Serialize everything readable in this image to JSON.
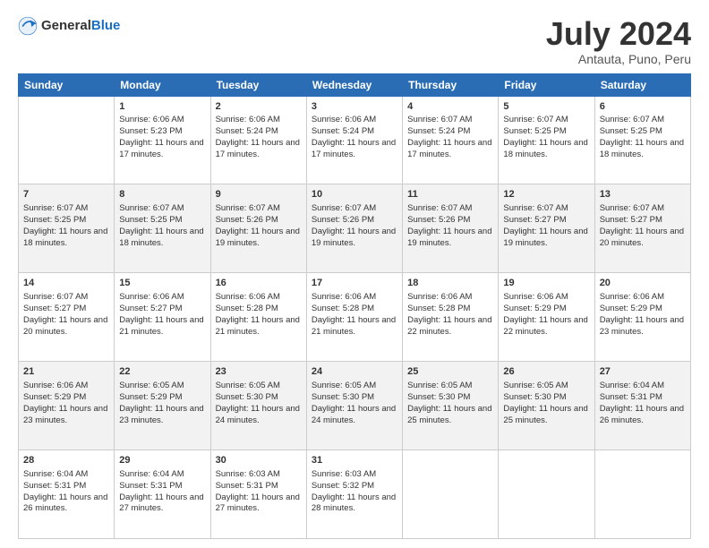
{
  "header": {
    "logo": {
      "general": "General",
      "blue": "Blue"
    },
    "title": "July 2024",
    "subtitle": "Antauta, Puno, Peru"
  },
  "weekdays": [
    "Sunday",
    "Monday",
    "Tuesday",
    "Wednesday",
    "Thursday",
    "Friday",
    "Saturday"
  ],
  "weeks": [
    [
      {
        "day": null,
        "sunrise": null,
        "sunset": null,
        "daylight": null
      },
      {
        "day": 1,
        "sunrise": "6:06 AM",
        "sunset": "5:23 PM",
        "daylight": "11 hours and 17 minutes."
      },
      {
        "day": 2,
        "sunrise": "6:06 AM",
        "sunset": "5:24 PM",
        "daylight": "11 hours and 17 minutes."
      },
      {
        "day": 3,
        "sunrise": "6:06 AM",
        "sunset": "5:24 PM",
        "daylight": "11 hours and 17 minutes."
      },
      {
        "day": 4,
        "sunrise": "6:07 AM",
        "sunset": "5:24 PM",
        "daylight": "11 hours and 17 minutes."
      },
      {
        "day": 5,
        "sunrise": "6:07 AM",
        "sunset": "5:25 PM",
        "daylight": "11 hours and 18 minutes."
      },
      {
        "day": 6,
        "sunrise": "6:07 AM",
        "sunset": "5:25 PM",
        "daylight": "11 hours and 18 minutes."
      }
    ],
    [
      {
        "day": 7,
        "sunrise": "6:07 AM",
        "sunset": "5:25 PM",
        "daylight": "11 hours and 18 minutes."
      },
      {
        "day": 8,
        "sunrise": "6:07 AM",
        "sunset": "5:25 PM",
        "daylight": "11 hours and 18 minutes."
      },
      {
        "day": 9,
        "sunrise": "6:07 AM",
        "sunset": "5:26 PM",
        "daylight": "11 hours and 19 minutes."
      },
      {
        "day": 10,
        "sunrise": "6:07 AM",
        "sunset": "5:26 PM",
        "daylight": "11 hours and 19 minutes."
      },
      {
        "day": 11,
        "sunrise": "6:07 AM",
        "sunset": "5:26 PM",
        "daylight": "11 hours and 19 minutes."
      },
      {
        "day": 12,
        "sunrise": "6:07 AM",
        "sunset": "5:27 PM",
        "daylight": "11 hours and 19 minutes."
      },
      {
        "day": 13,
        "sunrise": "6:07 AM",
        "sunset": "5:27 PM",
        "daylight": "11 hours and 20 minutes."
      }
    ],
    [
      {
        "day": 14,
        "sunrise": "6:07 AM",
        "sunset": "5:27 PM",
        "daylight": "11 hours and 20 minutes."
      },
      {
        "day": 15,
        "sunrise": "6:06 AM",
        "sunset": "5:27 PM",
        "daylight": "11 hours and 21 minutes."
      },
      {
        "day": 16,
        "sunrise": "6:06 AM",
        "sunset": "5:28 PM",
        "daylight": "11 hours and 21 minutes."
      },
      {
        "day": 17,
        "sunrise": "6:06 AM",
        "sunset": "5:28 PM",
        "daylight": "11 hours and 21 minutes."
      },
      {
        "day": 18,
        "sunrise": "6:06 AM",
        "sunset": "5:28 PM",
        "daylight": "11 hours and 22 minutes."
      },
      {
        "day": 19,
        "sunrise": "6:06 AM",
        "sunset": "5:29 PM",
        "daylight": "11 hours and 22 minutes."
      },
      {
        "day": 20,
        "sunrise": "6:06 AM",
        "sunset": "5:29 PM",
        "daylight": "11 hours and 23 minutes."
      }
    ],
    [
      {
        "day": 21,
        "sunrise": "6:06 AM",
        "sunset": "5:29 PM",
        "daylight": "11 hours and 23 minutes."
      },
      {
        "day": 22,
        "sunrise": "6:05 AM",
        "sunset": "5:29 PM",
        "daylight": "11 hours and 23 minutes."
      },
      {
        "day": 23,
        "sunrise": "6:05 AM",
        "sunset": "5:30 PM",
        "daylight": "11 hours and 24 minutes."
      },
      {
        "day": 24,
        "sunrise": "6:05 AM",
        "sunset": "5:30 PM",
        "daylight": "11 hours and 24 minutes."
      },
      {
        "day": 25,
        "sunrise": "6:05 AM",
        "sunset": "5:30 PM",
        "daylight": "11 hours and 25 minutes."
      },
      {
        "day": 26,
        "sunrise": "6:05 AM",
        "sunset": "5:30 PM",
        "daylight": "11 hours and 25 minutes."
      },
      {
        "day": 27,
        "sunrise": "6:04 AM",
        "sunset": "5:31 PM",
        "daylight": "11 hours and 26 minutes."
      }
    ],
    [
      {
        "day": 28,
        "sunrise": "6:04 AM",
        "sunset": "5:31 PM",
        "daylight": "11 hours and 26 minutes."
      },
      {
        "day": 29,
        "sunrise": "6:04 AM",
        "sunset": "5:31 PM",
        "daylight": "11 hours and 27 minutes."
      },
      {
        "day": 30,
        "sunrise": "6:03 AM",
        "sunset": "5:31 PM",
        "daylight": "11 hours and 27 minutes."
      },
      {
        "day": 31,
        "sunrise": "6:03 AM",
        "sunset": "5:32 PM",
        "daylight": "11 hours and 28 minutes."
      },
      {
        "day": null,
        "sunrise": null,
        "sunset": null,
        "daylight": null
      },
      {
        "day": null,
        "sunrise": null,
        "sunset": null,
        "daylight": null
      },
      {
        "day": null,
        "sunrise": null,
        "sunset": null,
        "daylight": null
      }
    ]
  ]
}
